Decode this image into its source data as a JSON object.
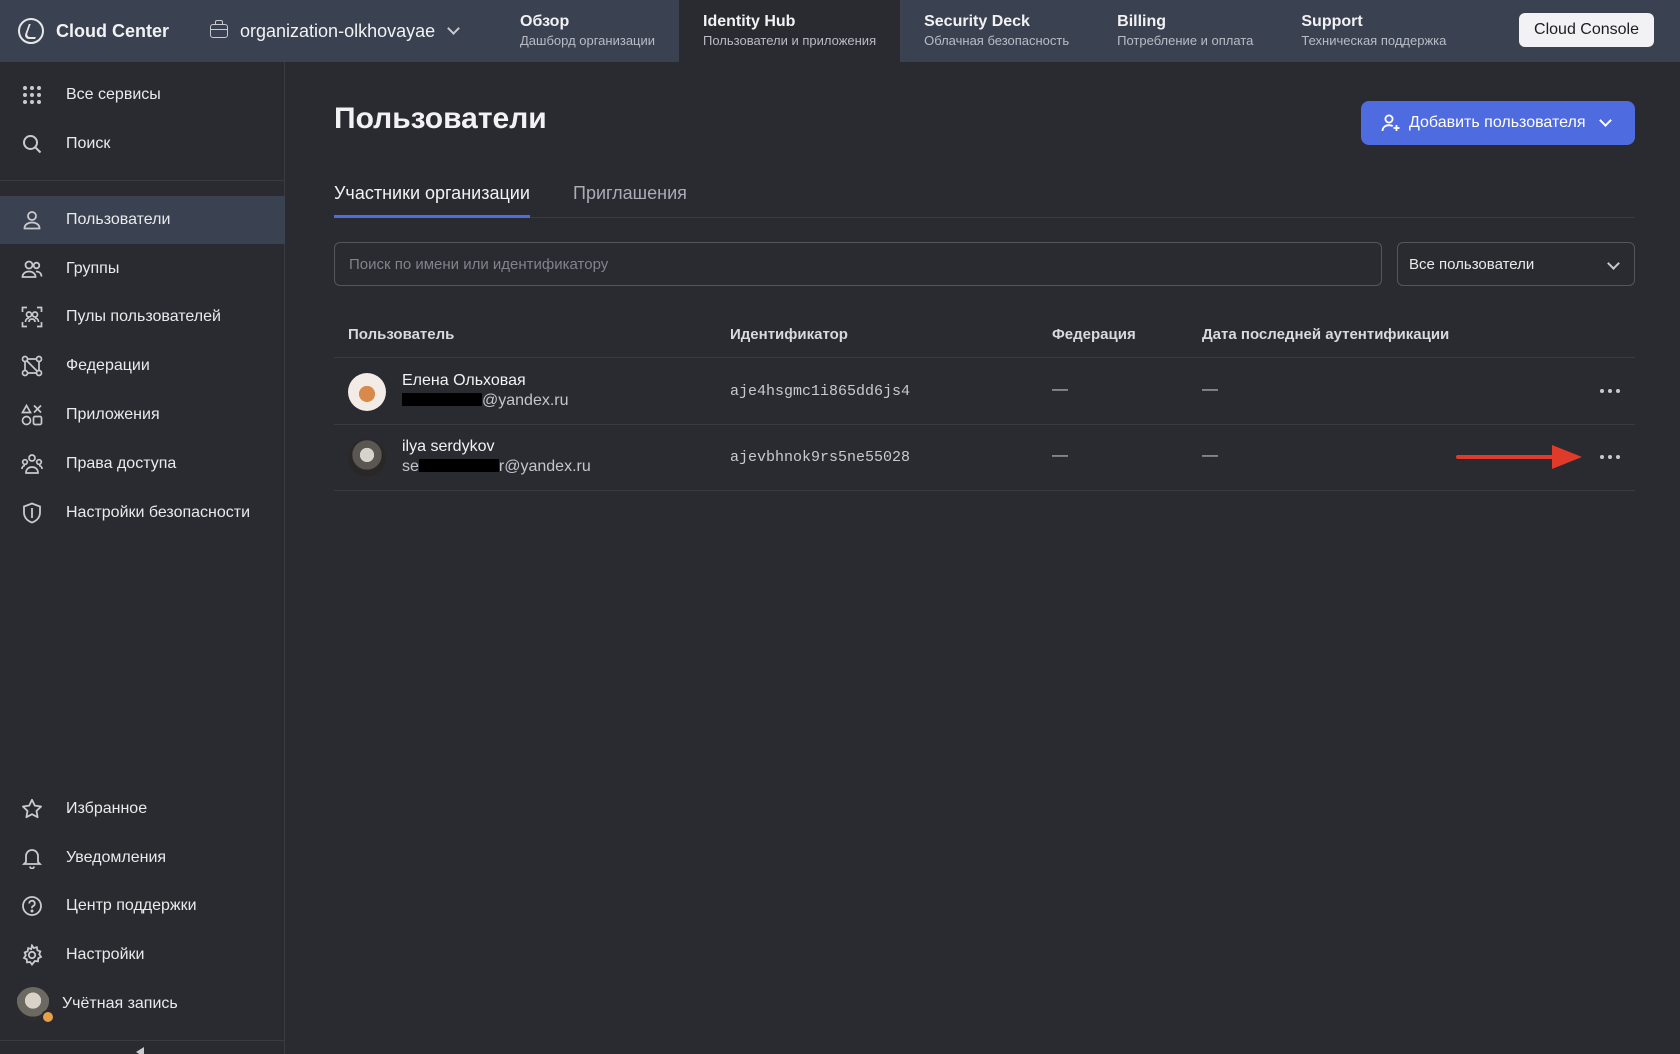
{
  "topbar": {
    "brand": "Cloud Center",
    "org": "organization-olkhovayae",
    "tabs": [
      {
        "title": "Обзор",
        "subtitle": "Дашборд организации"
      },
      {
        "title": "Identity Hub",
        "subtitle": "Пользователи и приложения"
      },
      {
        "title": "Security Deck",
        "subtitle": "Облачная безопасность"
      },
      {
        "title": "Billing",
        "subtitle": "Потребление и оплата"
      },
      {
        "title": "Support",
        "subtitle": "Техническая поддержка"
      }
    ],
    "console_button": "Cloud Console"
  },
  "sidebar": {
    "top_items": [
      {
        "label": "Все сервисы",
        "icon": "grid-icon"
      },
      {
        "label": "Поиск",
        "icon": "search-icon"
      }
    ],
    "items": [
      {
        "label": "Пользователи",
        "icon": "user-icon"
      },
      {
        "label": "Группы",
        "icon": "group-icon"
      },
      {
        "label": "Пулы пользователей",
        "icon": "user-pool-icon"
      },
      {
        "label": "Федерации",
        "icon": "federation-icon"
      },
      {
        "label": "Приложения",
        "icon": "apps-icon"
      },
      {
        "label": "Права доступа",
        "icon": "access-icon"
      },
      {
        "label": "Настройки безопасности",
        "icon": "shield-icon"
      }
    ],
    "bottom_items": [
      {
        "label": "Избранное",
        "icon": "star-icon"
      },
      {
        "label": "Уведомления",
        "icon": "bell-icon"
      },
      {
        "label": "Центр поддержки",
        "icon": "help-icon"
      },
      {
        "label": "Настройки",
        "icon": "gear-icon"
      },
      {
        "label": "Учётная запись",
        "icon": "avatar"
      }
    ]
  },
  "main": {
    "title": "Пользователи",
    "add_button": "Добавить пользователя",
    "tabs": [
      "Участники организации",
      "Приглашения"
    ],
    "search_placeholder": "Поиск по имени или идентификатору",
    "filter_value": "Все пользователи",
    "columns": [
      "Пользователь",
      "Идентификатор",
      "Федерация",
      "Дата последней аутентификации"
    ],
    "rows": [
      {
        "name": "Елена Ольховая",
        "email_prefix": "",
        "email_suffix": "@yandex.ru",
        "id": "aje4hsgmc1i865dd6js4",
        "federation": "—",
        "last_auth": "—"
      },
      {
        "name": "ilya serdykov",
        "email_prefix": "se",
        "email_suffix": "r@yandex.ru",
        "id": "ajevbhnok9rs5ne55028",
        "federation": "—",
        "last_auth": "—"
      }
    ]
  },
  "colors": {
    "accent": "#4f6be0",
    "annotation_arrow": "#e03a2a",
    "topbar": "#3a4150",
    "background": "#2a2a31"
  }
}
